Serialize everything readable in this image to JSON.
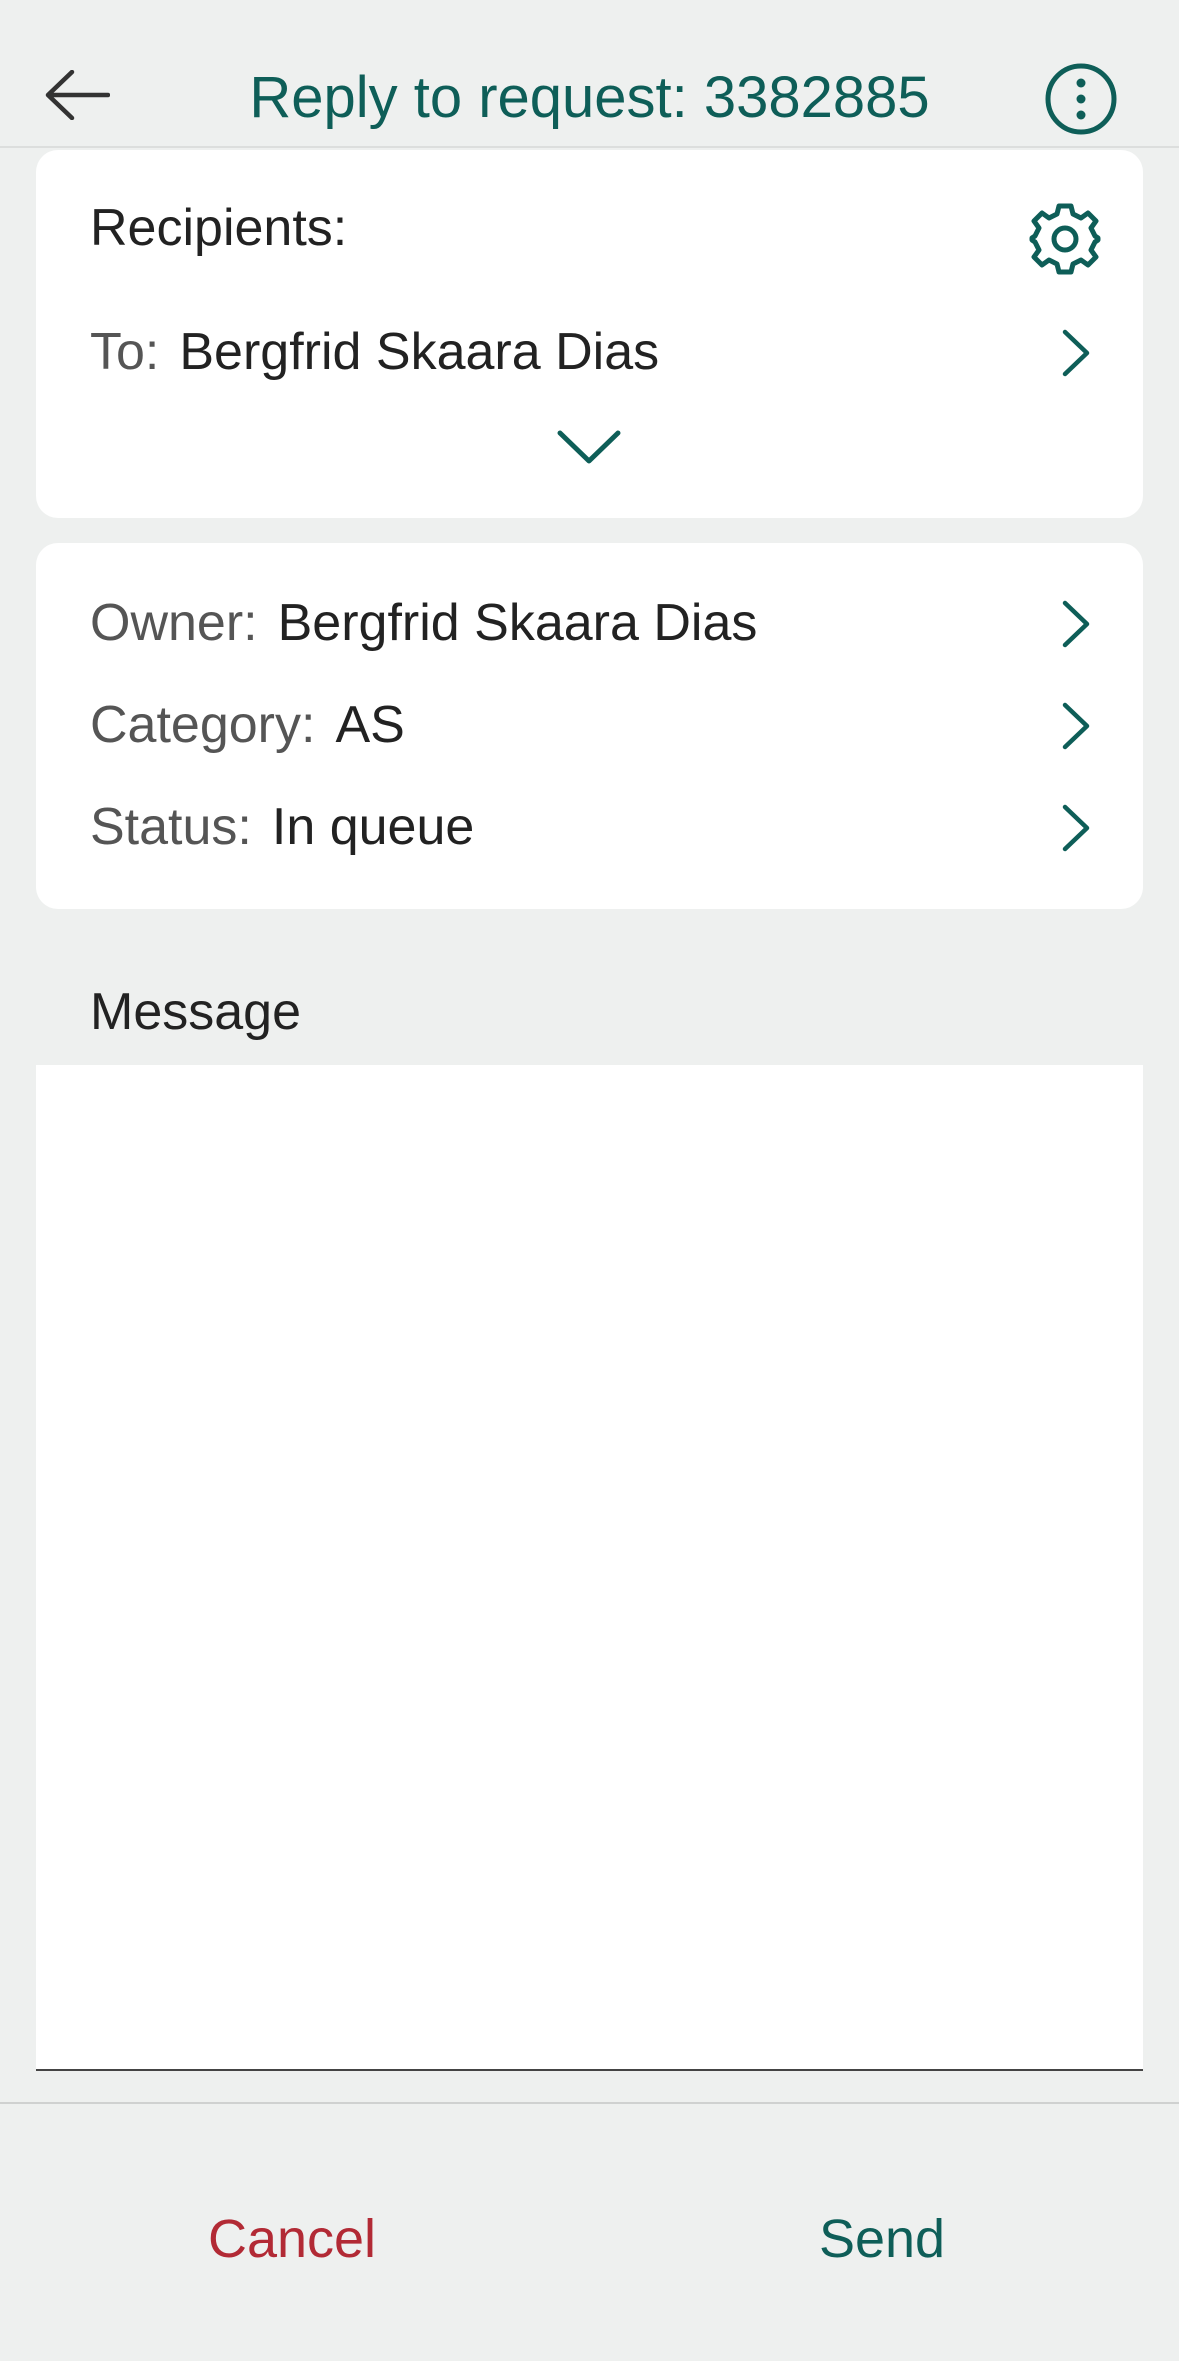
{
  "colors": {
    "accent": "#0e5e58",
    "danger": "#b22a35",
    "background": "#eef0ef",
    "card": "#ffffff"
  },
  "header": {
    "title": "Reply to request: 3382885",
    "back_icon": "arrow-left-icon",
    "more_icon": "more-vertical-icon"
  },
  "recipients": {
    "heading": "Recipients:",
    "settings_icon": "gear-icon",
    "to_label": "To:",
    "to_value": "Bergfrid Skaara Dias",
    "expand_icon": "chevron-down-icon"
  },
  "meta": {
    "owner_label": "Owner:",
    "owner_value": "Bergfrid Skaara Dias",
    "category_label": "Category:",
    "category_value": "AS",
    "status_label": "Status:",
    "status_value": "In queue"
  },
  "message": {
    "label": "Message",
    "value": ""
  },
  "footer": {
    "cancel_label": "Cancel",
    "send_label": "Send"
  }
}
